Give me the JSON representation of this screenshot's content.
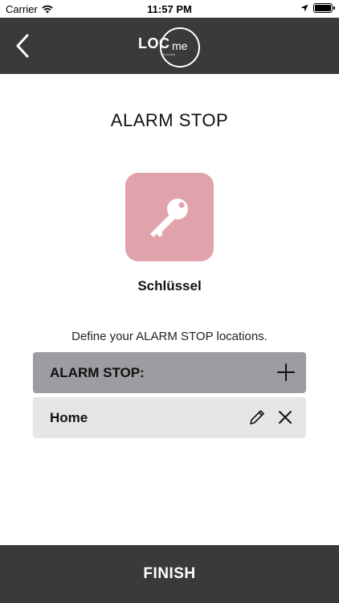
{
  "status_bar": {
    "carrier": "Carrier",
    "time": "11:57 PM",
    "icons": [
      "wifi-icon",
      "location-arrow-icon",
      "battery-icon"
    ]
  },
  "nav": {
    "back_icon": "chevron-left-icon",
    "logo": {
      "loc": "LOC",
      "me": "me",
      "by": "by lucom"
    }
  },
  "page": {
    "title": "ALARM STOP",
    "item": {
      "name": "Schlüssel",
      "icon": "key-icon",
      "tile_color": "#e0a3ab"
    },
    "instruction": "Define your ALARM STOP locations."
  },
  "list": {
    "header_label": "ALARM STOP:",
    "add_icon": "plus-icon",
    "locations": [
      {
        "label": "Home",
        "edit_icon": "pencil-icon",
        "delete_icon": "close-icon"
      }
    ]
  },
  "footer": {
    "finish_label": "FINISH"
  },
  "colors": {
    "bar_dark": "#3a3a3a",
    "header_gray": "#9c9ca1",
    "row_gray": "#e6e6e9",
    "accent_pink": "#e0a3ab"
  }
}
